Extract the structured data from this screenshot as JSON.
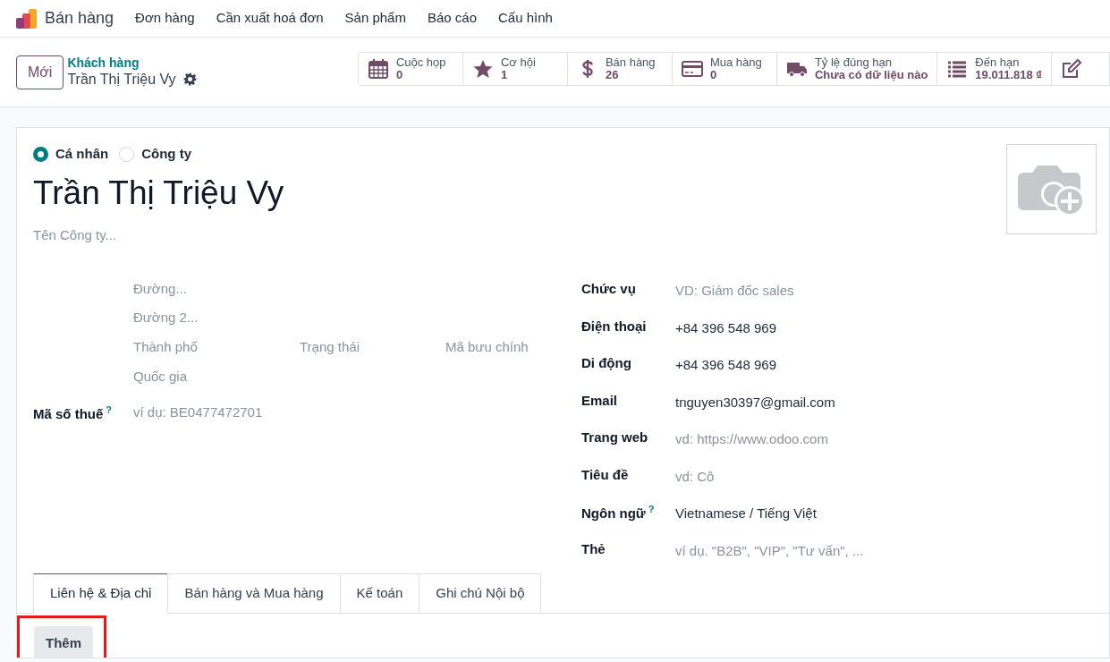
{
  "app": {
    "name": "Bán hàng"
  },
  "menu": [
    "Đơn hàng",
    "Cần xuất hoá đơn",
    "Sản phẩm",
    "Báo cáo",
    "Cấu hình"
  ],
  "control_panel": {
    "new_button": "Mới",
    "breadcrumb": "Khách hàng",
    "record": "Trần Thị Triệu Vy"
  },
  "stat_buttons": [
    {
      "kind": "calendar",
      "label": "Cuộc họp",
      "value": "0"
    },
    {
      "kind": "star",
      "label": "Cơ hội",
      "value": "1"
    },
    {
      "kind": "dollar",
      "label": "Bán hàng",
      "value": "26"
    },
    {
      "kind": "card",
      "label": "Mua hàng",
      "value": "0"
    },
    {
      "kind": "truck",
      "label": "Tỷ lệ đúng hạn",
      "value": "Chưa có dữ liệu nào"
    },
    {
      "kind": "list",
      "label": "Đến hạn",
      "value": "19.011.818 ₫"
    },
    {
      "kind": "edit"
    }
  ],
  "company_type": [
    {
      "label": "Cá nhân",
      "selected": true
    },
    {
      "label": "Công ty",
      "selected": false
    }
  ],
  "name": "Trần Thị Triệu Vy",
  "company_placeholder": "Tên Công ty...",
  "address": {
    "street": "Đường...",
    "street2": "Đường 2...",
    "city": "Thành phố",
    "state": "Trạng thái",
    "zip": "Mã bưu chính",
    "country": "Quốc gia"
  },
  "tax": {
    "label": "Mã số thuế",
    "help": "?",
    "placeholder": "ví dụ: BE0477472701"
  },
  "fields": [
    {
      "label": "Chức vụ",
      "placeholder": "VD: Giám đốc sales"
    },
    {
      "label": "Điện thoại",
      "value": "+84 396 548 969"
    },
    {
      "label": "Di động",
      "value": "+84 396 548 969"
    },
    {
      "label": "Email",
      "value": "tnguyen30397@gmail.com"
    },
    {
      "label": "Trang web",
      "placeholder": "vd: https://www.odoo.com"
    },
    {
      "label": "Tiêu đề",
      "placeholder": "vd: Cô"
    },
    {
      "label": "Ngôn ngữ",
      "help": "?",
      "value": "Vietnamese / Tiếng Việt"
    },
    {
      "label": "Thẻ",
      "placeholder": "ví dụ. \"B2B\", \"VIP\", \"Tư vấn\", ..."
    }
  ],
  "tabs": [
    {
      "label": "Liên hệ & Địa chỉ",
      "selected": true
    },
    {
      "label": "Bán hàng và Mua hàng",
      "selected": false
    },
    {
      "label": "Kế toán",
      "selected": false
    },
    {
      "label": "Ghi chú Nội bộ",
      "selected": false
    }
  ],
  "add_button": {
    "label": "Thêm",
    "highlighted": true
  }
}
